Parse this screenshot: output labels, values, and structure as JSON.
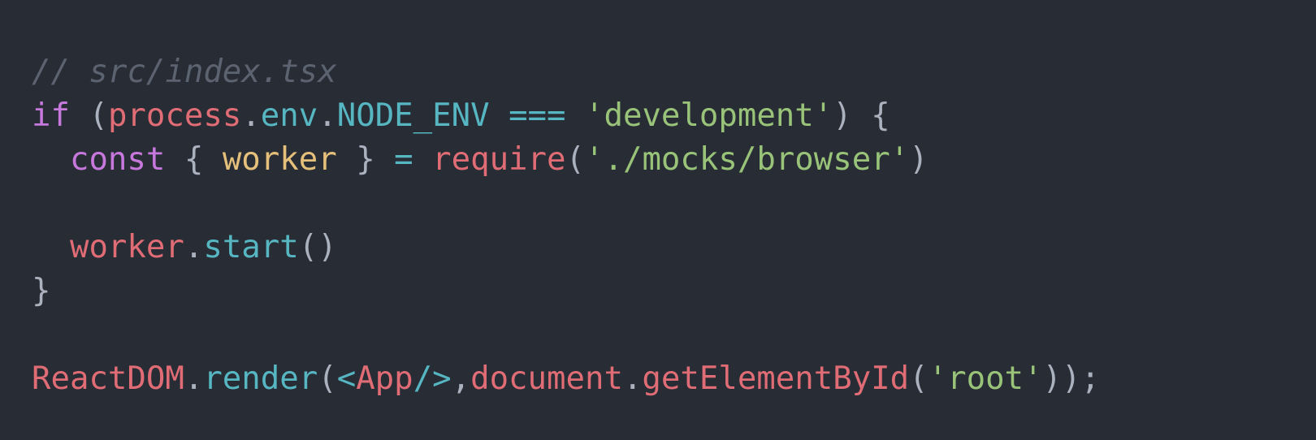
{
  "editor": {
    "background": "#282c34",
    "theme_colors": {
      "comment": "#5c6370",
      "keyword": "#c678dd",
      "variable": "#e06c75",
      "property": "#56b6c2",
      "string": "#98c379",
      "destructured": "#e5c07b",
      "punctuation": "#abb2bf"
    },
    "lines": [
      {
        "tokens": [
          {
            "type": "comment",
            "text": "// src/index.tsx"
          }
        ]
      },
      {
        "tokens": [
          {
            "type": "keyword",
            "text": "if"
          },
          {
            "type": "punct",
            "text": " ("
          },
          {
            "type": "var",
            "text": "process"
          },
          {
            "type": "punct",
            "text": "."
          },
          {
            "type": "prop",
            "text": "env"
          },
          {
            "type": "punct",
            "text": "."
          },
          {
            "type": "prop",
            "text": "NODE_ENV"
          },
          {
            "type": "punct",
            "text": " "
          },
          {
            "type": "op",
            "text": "==="
          },
          {
            "type": "punct",
            "text": " "
          },
          {
            "type": "str",
            "text": "'development'"
          },
          {
            "type": "punct",
            "text": ") {"
          }
        ]
      },
      {
        "tokens": [
          {
            "type": "punct",
            "text": "  "
          },
          {
            "type": "keyword",
            "text": "const"
          },
          {
            "type": "punct",
            "text": " { "
          },
          {
            "type": "destr",
            "text": "worker"
          },
          {
            "type": "punct",
            "text": " } "
          },
          {
            "type": "op",
            "text": "="
          },
          {
            "type": "punct",
            "text": " "
          },
          {
            "type": "var",
            "text": "require"
          },
          {
            "type": "punct",
            "text": "("
          },
          {
            "type": "str",
            "text": "'./mocks/browser'"
          },
          {
            "type": "punct",
            "text": ")"
          }
        ]
      },
      {
        "tokens": []
      },
      {
        "tokens": [
          {
            "type": "punct",
            "text": "  "
          },
          {
            "type": "var",
            "text": "worker"
          },
          {
            "type": "punct",
            "text": "."
          },
          {
            "type": "prop",
            "text": "start"
          },
          {
            "type": "punct",
            "text": "()"
          }
        ]
      },
      {
        "tokens": [
          {
            "type": "punct",
            "text": "}"
          }
        ]
      },
      {
        "tokens": []
      },
      {
        "tokens": [
          {
            "type": "var",
            "text": "ReactDOM"
          },
          {
            "type": "punct",
            "text": "."
          },
          {
            "type": "prop",
            "text": "render"
          },
          {
            "type": "punct",
            "text": "("
          },
          {
            "type": "op",
            "text": "<"
          },
          {
            "type": "var",
            "text": "App"
          },
          {
            "type": "op",
            "text": "/>"
          },
          {
            "type": "punct",
            "text": ","
          },
          {
            "type": "var",
            "text": "document"
          },
          {
            "type": "punct",
            "text": "."
          },
          {
            "type": "var",
            "text": "getElementById"
          },
          {
            "type": "punct",
            "text": "("
          },
          {
            "type": "str",
            "text": "'root'"
          },
          {
            "type": "punct",
            "text": "));"
          }
        ]
      }
    ]
  }
}
